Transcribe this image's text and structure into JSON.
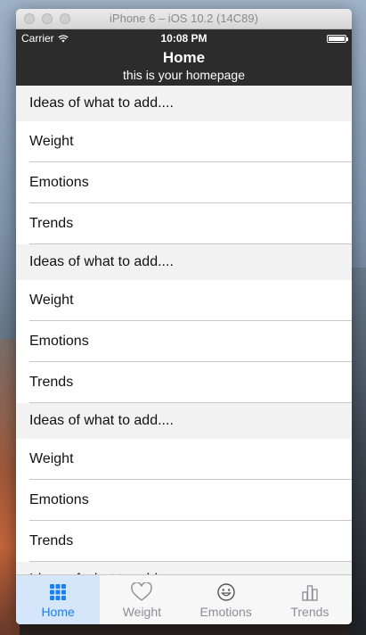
{
  "window": {
    "title": "iPhone 6 – iOS 10.2 (14C89)"
  },
  "status_bar": {
    "carrier": "Carrier",
    "time": "10:08 PM",
    "battery_level": 1.0
  },
  "nav": {
    "title": "Home",
    "subtitle": "this is your homepage"
  },
  "sections": [
    {
      "header": "Ideas of what to add....",
      "rows": [
        "Weight",
        "Emotions",
        "Trends"
      ]
    },
    {
      "header": "Ideas of what to add....",
      "rows": [
        "Weight",
        "Emotions",
        "Trends"
      ]
    },
    {
      "header": "Ideas of what to add....",
      "rows": [
        "Weight",
        "Emotions",
        "Trends"
      ]
    },
    {
      "header": "Ideas of what to add....",
      "rows": []
    }
  ],
  "tabs": [
    {
      "label": "Home",
      "icon": "grid-icon",
      "active": true
    },
    {
      "label": "Weight",
      "icon": "heart-icon",
      "active": false
    },
    {
      "label": "Emotions",
      "icon": "smiley-icon",
      "active": false
    },
    {
      "label": "Trends",
      "icon": "bar-chart-icon",
      "active": false
    }
  ],
  "colors": {
    "accent": "#147efb",
    "bar": "#2c2c2c",
    "section_bg": "#f2f2f2"
  }
}
